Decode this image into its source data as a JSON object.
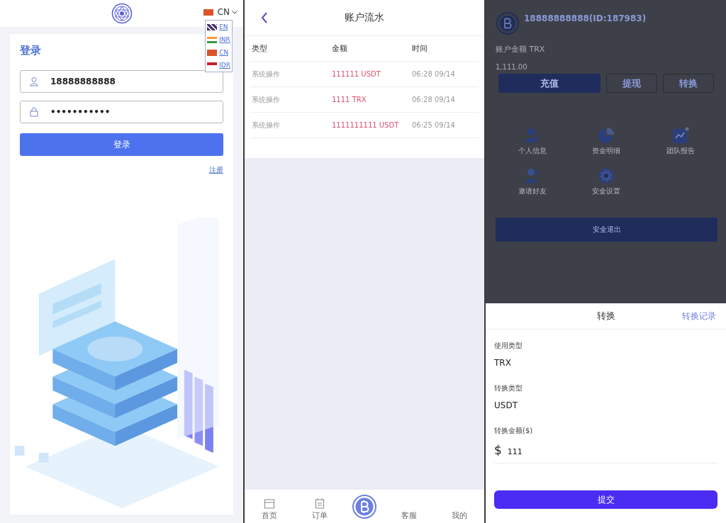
{
  "login": {
    "language": "CN",
    "languages": [
      {
        "label": "EN"
      },
      {
        "label": "INR"
      },
      {
        "label": "CN"
      },
      {
        "label": "IDR"
      }
    ],
    "title": "登录",
    "phone": "18888888888",
    "password": "•••••••••••",
    "submit": "登录",
    "register": "注册"
  },
  "ledger": {
    "title": "账户流水",
    "columns": [
      "类型",
      "金额",
      "时间"
    ],
    "rows": [
      {
        "type": "系统操作",
        "amount": "111111 USDT",
        "time": "06:28 09/14"
      },
      {
        "type": "系统操作",
        "amount": "1111 TRX",
        "time": "06:28 09/14"
      },
      {
        "type": "系统操作",
        "amount": "1111111111 USDT",
        "time": "06:25 09/14"
      }
    ],
    "nav": [
      {
        "label": "首页"
      },
      {
        "label": "订单"
      },
      {
        "label": "客服"
      },
      {
        "label": "我的"
      }
    ]
  },
  "profile": {
    "user": "18888888888(ID:187983)",
    "balance_label": "账户金额 TRX",
    "balance": "1,111.00",
    "buttons": [
      "充值",
      "提现",
      "转换"
    ],
    "menu": [
      {
        "label": "个人信息"
      },
      {
        "label": "资金明细"
      },
      {
        "label": "团队报告"
      },
      {
        "label": "邀请好友"
      },
      {
        "label": "安全设置"
      }
    ],
    "logout": "安全退出"
  },
  "convert": {
    "title": "转换",
    "records_link": "转换记录",
    "fields": [
      {
        "label": "使用类型",
        "value": "TRX"
      },
      {
        "label": "转换类型",
        "value": "USDT"
      }
    ],
    "amount_label": "转换金额($)",
    "currency": "$",
    "amount": "111",
    "submit": "提交"
  }
}
